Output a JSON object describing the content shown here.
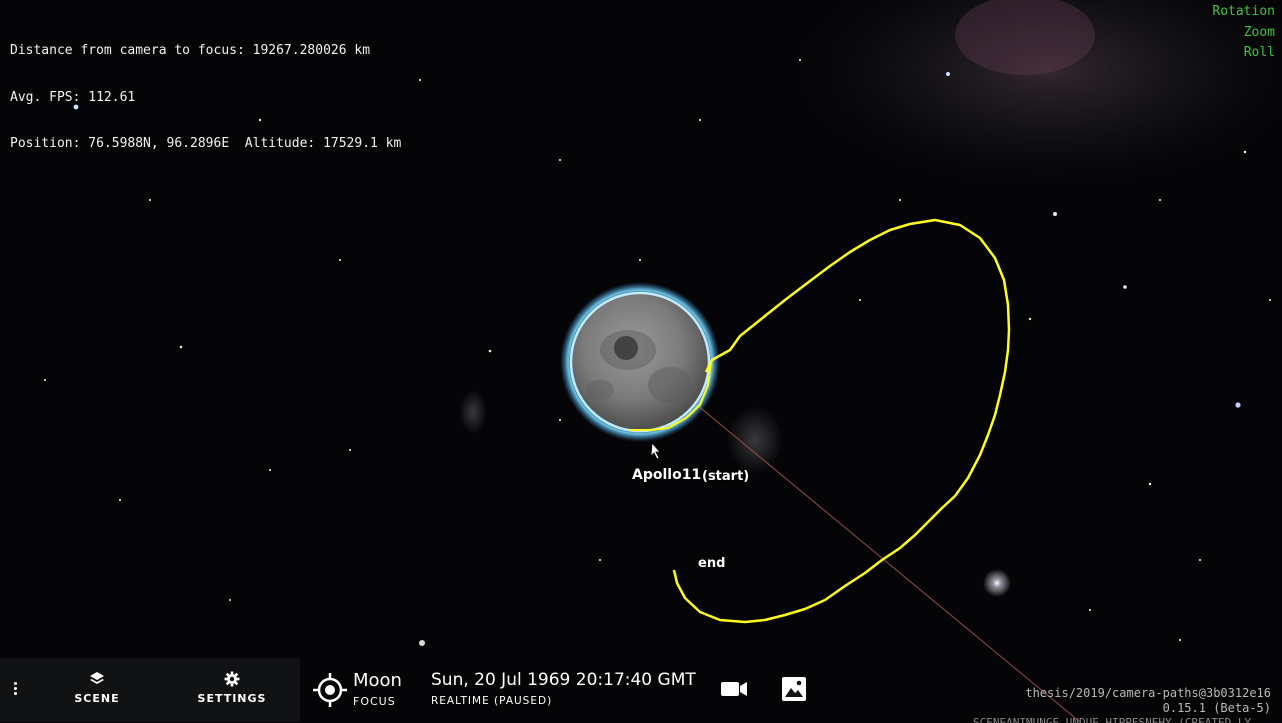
{
  "hud": {
    "distance": "Distance from camera to focus: 19267.280026 km",
    "fps": "Avg. FPS: 112.61",
    "position": "Position: 76.5988N, 96.2896E  Altitude: 17529.1 km"
  },
  "nav_modes": [
    "Rotation",
    "Zoom",
    "Roll"
  ],
  "labels": {
    "apollo": "Apollo11",
    "start": "(start)",
    "end": "end"
  },
  "menu": {
    "scene": "SCENE",
    "settings": "SETTINGS"
  },
  "focus": {
    "name": "Moon",
    "label": "FOCUS"
  },
  "time": {
    "datetime": "Sun, 20 Jul 1969 20:17:40 GMT",
    "mode": "REALTIME (PAUSED)"
  },
  "version": {
    "branch": "thesis/2019/camera-paths@3b0312e16",
    "number": "0.15.1 (Beta-5)",
    "cut_line": "SCENEANIMUNGE UNDUE  HIPPESNEHY (CREATED LY..."
  },
  "colors": {
    "trajectory": "#ffff1a",
    "nav_modes": "#3ec23e",
    "moon_glow": "#7ad8ff",
    "bottombar": "#111214"
  },
  "icons": [
    "scene-layers-icon",
    "settings-gear-icon",
    "focus-crosshair-icon",
    "camera-icon",
    "image-icon",
    "menu-kebab-icon",
    "cursor-icon"
  ]
}
